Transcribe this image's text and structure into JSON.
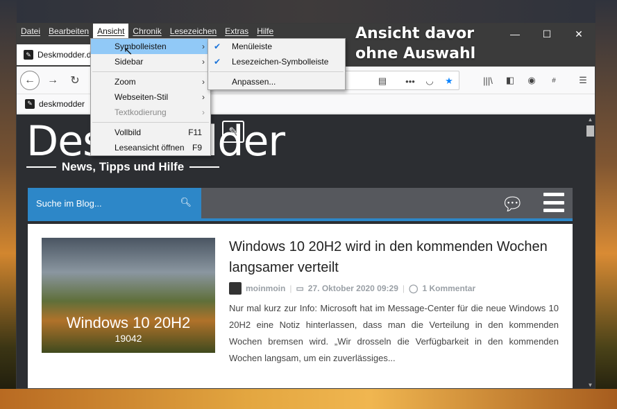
{
  "menubar": {
    "items": [
      "Datei",
      "Bearbeiten",
      "Ansicht",
      "Chronik",
      "Lesezeichen",
      "Extras",
      "Hilfe"
    ],
    "active_index": 2
  },
  "window_controls": {
    "minimize": "—",
    "maximize": "☐",
    "close": "✕"
  },
  "annotation": {
    "line1": "Ansicht davor",
    "line2": "ohne Auswahl"
  },
  "tab": {
    "title": "Deskmodder.d"
  },
  "bookmarks": {
    "item1": "deskmodder"
  },
  "view_menu": {
    "items": [
      {
        "label": "Symbolleisten",
        "type": "submenu",
        "highlight": true
      },
      {
        "label": "Sidebar",
        "type": "submenu"
      },
      {
        "type": "separator"
      },
      {
        "label": "Zoom",
        "type": "submenu"
      },
      {
        "label": "Webseiten-Stil",
        "type": "submenu"
      },
      {
        "label": "Textkodierung",
        "type": "submenu",
        "disabled": true
      },
      {
        "type": "separator"
      },
      {
        "label": "Vollbild",
        "shortcut": "F11"
      },
      {
        "label": "Leseansicht öffnen",
        "shortcut": "F9"
      }
    ]
  },
  "toolbars_submenu": {
    "items": [
      {
        "label": "Menüleiste",
        "checked": true
      },
      {
        "label": "Lesezeichen-Symbolleiste",
        "checked": true
      },
      {
        "label": "Anpassen...",
        "checked": false
      }
    ]
  },
  "site": {
    "logo": "Deskmodder",
    "tagline": "News, Tipps und Hilfe",
    "search_placeholder": "Suche im Blog..."
  },
  "post": {
    "thumb_title": "Windows 10 20H2",
    "thumb_sub": "19042",
    "title": "Windows 10 20H2 wird in den kommenden Wochen langsamer verteilt",
    "author": "moinmoin",
    "date": "27. Oktober 2020 09:29",
    "comments": "1 Kommentar",
    "excerpt": "Nur mal kurz zur Info: Microsoft hat im Message-Center für die neue Windows 10 20H2 eine Notiz hinterlassen, dass man die Verteilung in den kommenden Wochen bremsen wird. „Wir drosseln die Verfügbarkeit in den kommenden Wochen langsam, um ein zuverlässiges..."
  },
  "colors": {
    "accent": "#2d87c8",
    "menu_highlight": "#91c9f7",
    "chrome_dark": "#3b3b3b"
  }
}
